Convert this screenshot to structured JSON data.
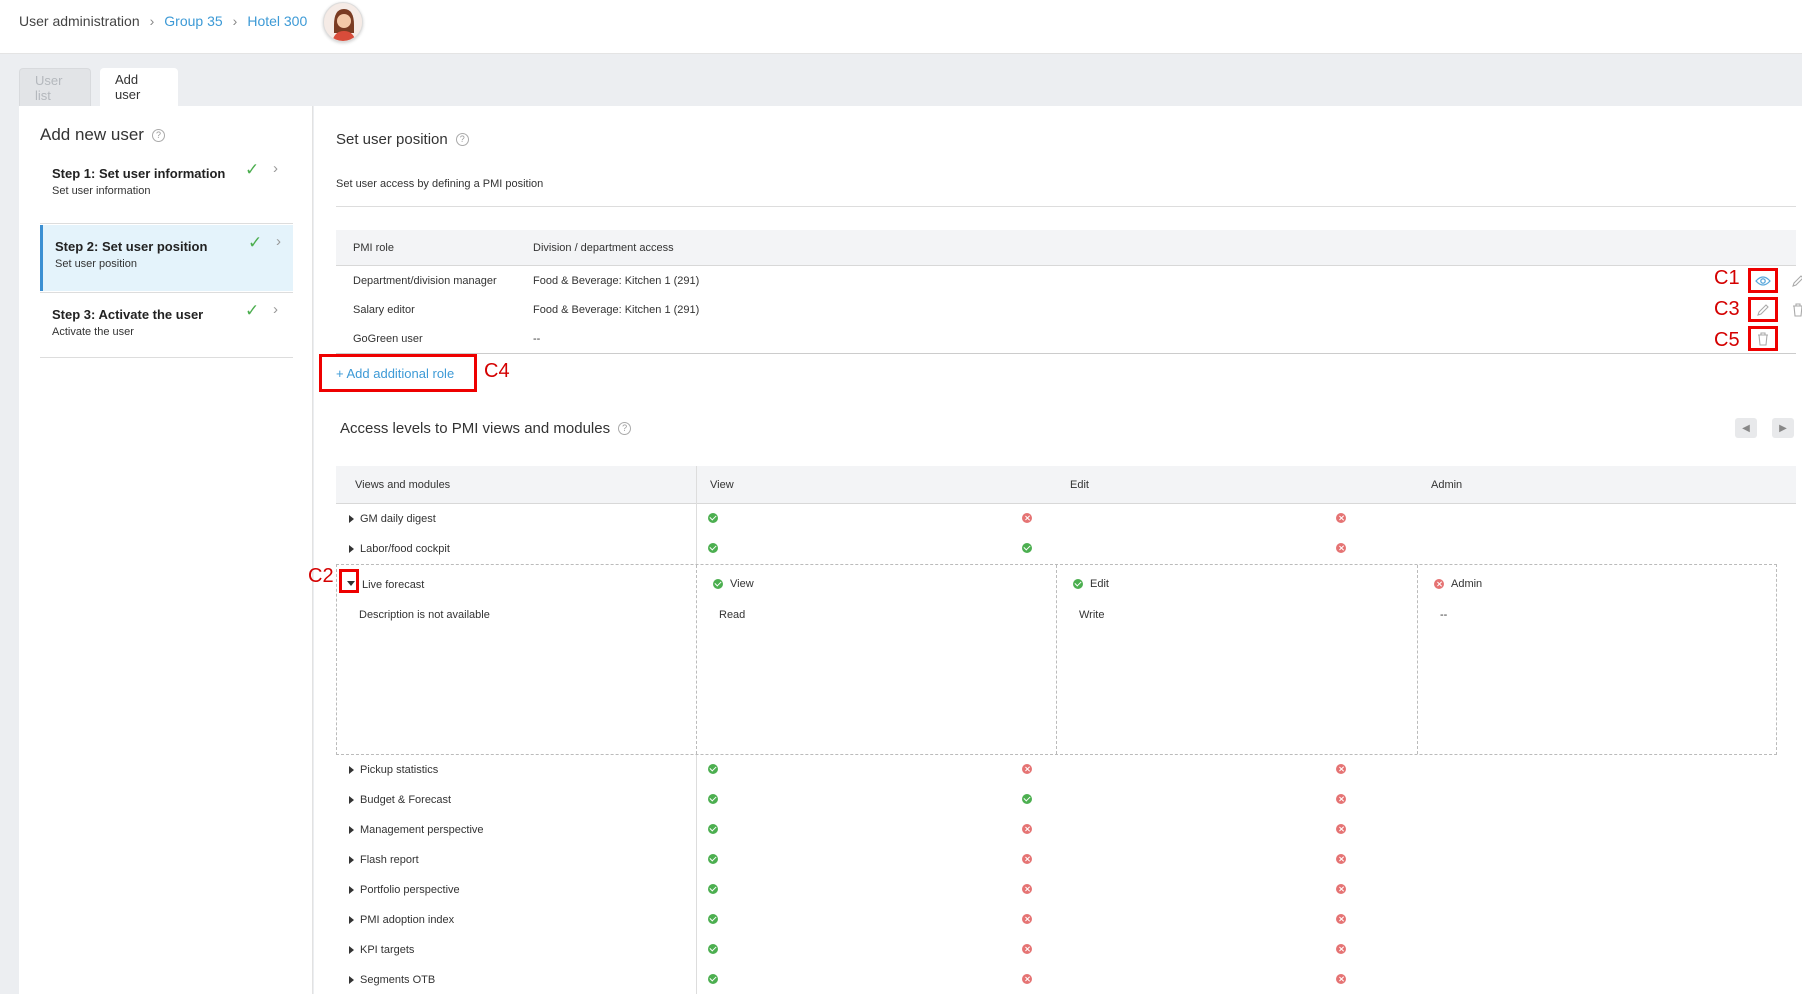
{
  "breadcrumb": {
    "root": "User administration",
    "items": [
      "Group 35",
      "Hotel 300"
    ]
  },
  "tabs": [
    {
      "label": "User list",
      "active": false
    },
    {
      "label": "Add user",
      "active": true
    }
  ],
  "left_panel": {
    "title": "Add new user",
    "steps": [
      {
        "title": "Step 1: Set user information",
        "subtitle": "Set user information"
      },
      {
        "title": "Step 2: Set user position",
        "subtitle": "Set user position"
      },
      {
        "title": "Step 3: Activate the user",
        "subtitle": "Activate the user"
      }
    ]
  },
  "main": {
    "title": "Set user position",
    "description": "Set user access by defining a PMI position",
    "role_table": {
      "headers": [
        "PMI role",
        "Division / department access"
      ],
      "rows": [
        {
          "role": "Department/division manager",
          "access": "Food & Beverage: Kitchen 1 (291)"
        },
        {
          "role": "Salary editor",
          "access": "Food & Beverage: Kitchen 1 (291)"
        },
        {
          "role": "GoGreen user",
          "access": "--"
        }
      ]
    },
    "add_role_label": "+ Add additional role",
    "annotations": {
      "c1": "C1",
      "c2": "C2",
      "c3": "C3",
      "c4": "C4",
      "c5": "C5"
    },
    "access_title": "Access levels to PMI views and modules",
    "module_table": {
      "headers": [
        "Views and modules",
        "View",
        "Edit",
        "Admin"
      ],
      "rows_top": [
        {
          "name": "GM daily digest",
          "view": "ok",
          "edit": "no",
          "admin": "no"
        },
        {
          "name": "Labor/food cockpit",
          "view": "ok",
          "edit": "ok",
          "admin": "no"
        }
      ],
      "expanded": {
        "name": "Live forecast",
        "description": "Description is not available",
        "view_label": "View",
        "view_desc": "Read",
        "edit_label": "Edit",
        "edit_desc": "Write",
        "admin_label": "Admin",
        "admin_desc": "--"
      },
      "rows_bottom": [
        {
          "name": "Pickup statistics",
          "view": "ok",
          "edit": "no",
          "admin": "no"
        },
        {
          "name": "Budget & Forecast",
          "view": "ok",
          "edit": "ok",
          "admin": "no"
        },
        {
          "name": "Management perspective",
          "view": "ok",
          "edit": "no",
          "admin": "no"
        },
        {
          "name": "Flash report",
          "view": "ok",
          "edit": "no",
          "admin": "no"
        },
        {
          "name": "Portfolio perspective",
          "view": "ok",
          "edit": "no",
          "admin": "no"
        },
        {
          "name": "PMI adoption index",
          "view": "ok",
          "edit": "no",
          "admin": "no"
        },
        {
          "name": "KPI targets",
          "view": "ok",
          "edit": "no",
          "admin": "no"
        },
        {
          "name": "Segments OTB",
          "view": "ok",
          "edit": "no",
          "admin": "no"
        }
      ]
    }
  },
  "colors": {
    "accent": "#3d9ad6",
    "ok": "#4caf50",
    "no": "#e57373",
    "highlight": "#e00000"
  }
}
